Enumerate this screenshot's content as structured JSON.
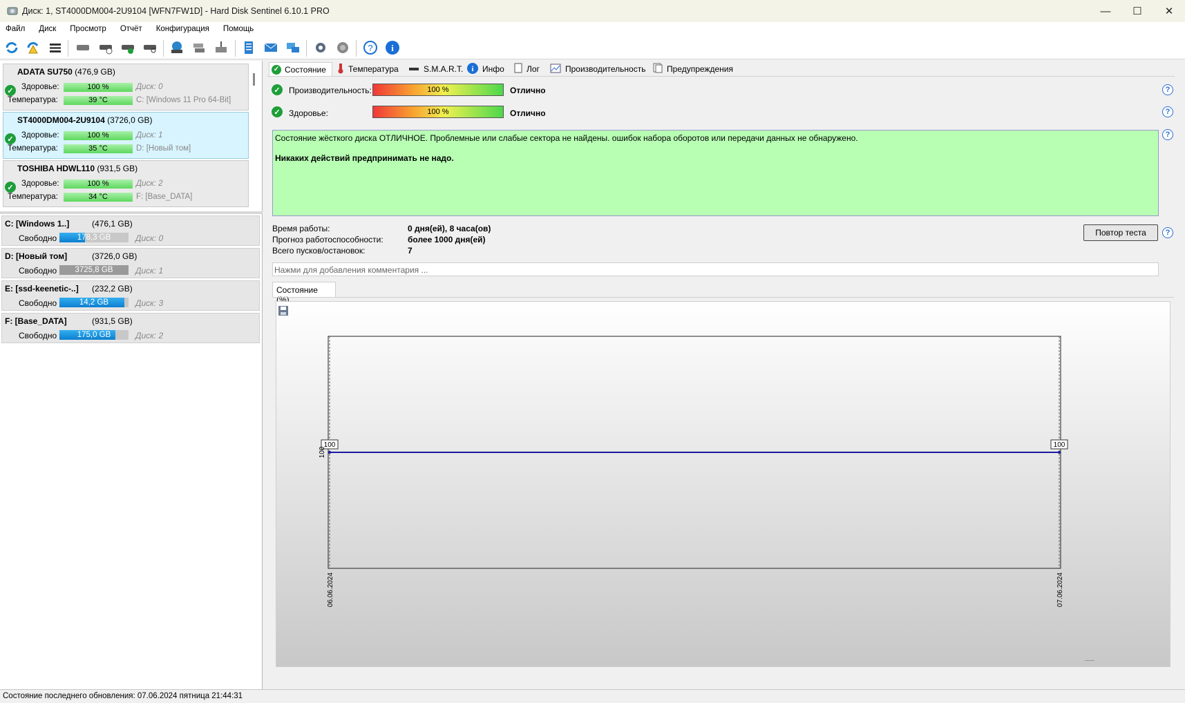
{
  "window": {
    "title": "Диск: 1, ST4000DM004-2U9104 [WFN7FW1D]  -  Hard Disk Sentinel 6.10.1 PRO",
    "minimize": "—",
    "maximize": "☐",
    "close": "✕"
  },
  "menu": [
    "Файл",
    "Диск",
    "Просмотр",
    "Отчёт",
    "Конфигурация",
    "Помощь"
  ],
  "disks": [
    {
      "name": "ADATA SU750",
      "size": "(476,9 GB)",
      "health_label": "Здоровье:",
      "health": "100 %",
      "disk": "Диск: 0",
      "temp_label": "Температура:",
      "temp": "39 °C",
      "volume": "C: [Windows 11 Pro 64-Bit]"
    },
    {
      "name": "ST4000DM004-2U9104",
      "size": "(3726,0 GB)",
      "health_label": "Здоровье:",
      "health": "100 %",
      "disk": "Диск: 1",
      "temp_label": "Температура:",
      "temp": "35 °C",
      "volume": "D: [Новый том]"
    },
    {
      "name": "TOSHIBA HDWL110",
      "size": "(931,5 GB)",
      "health_label": "Здоровье:",
      "health": "100 %",
      "disk": "Диск: 2",
      "temp_label": "Температура:",
      "temp": "34 °C",
      "volume": "F: [Base_DATA]"
    }
  ],
  "volumes": [
    {
      "name": "C: [Windows 1..]",
      "size": "(476,1 GB)",
      "free_label": "Свободно",
      "free": "178,3 GB",
      "free_fraction": 0.37,
      "disk": "Диск: 0"
    },
    {
      "name": "D: [Новый том]",
      "size": "(3726,0 GB)",
      "free_label": "Свободно",
      "free": "3725,8 GB",
      "free_fraction": 0.0,
      "disk": "Диск: 1"
    },
    {
      "name": "E: [ssd-keenetic-..]",
      "size": "(232,2 GB)",
      "free_label": "Свободно",
      "free": "14,2 GB",
      "free_fraction": 0.94,
      "disk": "Диск: 3"
    },
    {
      "name": "F: [Base_DATA]",
      "size": "(931,5 GB)",
      "free_label": "Свободно",
      "free": "175,0 GB",
      "free_fraction": 0.81,
      "disk": "Диск: 2"
    }
  ],
  "tabs": [
    "Состояние",
    "Температура",
    "S.M.A.R.T.",
    "Инфо",
    "Лог",
    "Производительность",
    "Предупреждения"
  ],
  "status": {
    "performance_label": "Производительность:",
    "performance_value": "100 %",
    "performance_text": "Отлично",
    "health_label": "Здоровье:",
    "health_value": "100 %",
    "health_text": "Отлично",
    "message": "Состояние жёсткого диска ОТЛИЧНОЕ. Проблемные или слабые сектора не найдены. ошибок набора оборотов или передачи данных не обнаружено.",
    "action": "Никаких действий предпринимать не надо.",
    "uptime_label": "Время работы:",
    "uptime": "0 дня(ей), 8 часа(ов)",
    "forecast_label": "Прогноз работоспособности:",
    "forecast": "более 1000 дня(ей)",
    "starts_label": "Всего пусков/остановок:",
    "starts": "7",
    "retest_button": "Повтор теста",
    "comment_placeholder": "Нажми для добавления комментария ..."
  },
  "chart_tab": "Состояние (%)",
  "chart_data": {
    "type": "line",
    "x": [
      "06.06.2024",
      "07.06.2024"
    ],
    "series": [
      {
        "values": [
          100,
          100
        ]
      }
    ],
    "data_labels": [
      "100",
      "100"
    ],
    "ytick": "100",
    "ylim": [
      0,
      200
    ],
    "color": "#1a1aa0"
  },
  "statusbar": "Состояние последнего обновления: 07.06.2024 пятница 21:44:31"
}
